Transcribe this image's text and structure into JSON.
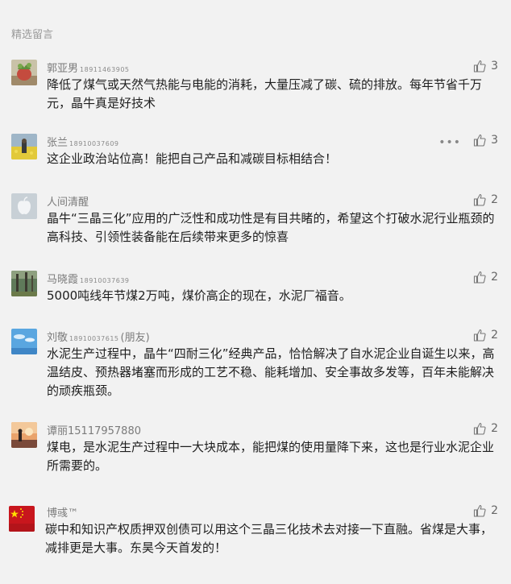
{
  "section_title": "精选留言",
  "comments": [
    {
      "name": "郭亚男",
      "phone": "18911463905",
      "text": "降低了煤气或天然气热能与电能的消耗，大量压减了碳、硫的排放。每年节省千万元，晶牛真是好技术",
      "likes": "3",
      "avatar": "avatar-plant"
    },
    {
      "name": "张兰",
      "phone": "18910037609",
      "text": "这企业政治站位高！能把自己产品和减碳目标相结合！",
      "likes": "3",
      "more": "•••",
      "avatar": "avatar-flower-field"
    },
    {
      "name": "人间清醒",
      "text": "晶牛“三晶三化”应用的广泛性和成功性是有目共睹的，希望这个打破水泥行业瓶颈的高科技、引领性装备能在后续带来更多的惊喜",
      "likes": "2",
      "avatar": "avatar-apple"
    },
    {
      "name": "马晓霞",
      "phone": "18910037639",
      "text": "5000吨线年节煤2万吨，煤价高企的现在，水泥厂福音。",
      "likes": "2",
      "avatar": "avatar-forest"
    },
    {
      "name": "刘敬",
      "phone": "18910037615",
      "suffix": "(朋友)",
      "text": "水泥生产过程中，晶牛“四耐三化”经典产品，恰恰解决了自水泥企业自诞生以来，高温结皮、预热器堵塞而形成的工艺不稳、能耗增加、安全事故多发等，百年未能解决的顽疾瓶颈。",
      "likes": "2",
      "avatar": "avatar-sky"
    },
    {
      "name": "谭丽",
      "phone_big": "15117957880",
      "text": "煤电，是水泥生产过程中一大块成本，能把煤的使用量降下来，这也是行业水泥企业所需要的。",
      "likes": "2",
      "avatar": "avatar-sunset"
    },
    {
      "name": "博彧™",
      "text": "碳中和知识产权质押双创债可以用这个三晶三化技术去对接一下直融。省煤是大事，减排更是大事。东昊今天首发的！",
      "likes": "2",
      "avatar": "avatar-flag"
    }
  ],
  "colors": {
    "background": "#f2f2f2",
    "name": "#7b7b7b",
    "text": "#1e1e1e"
  },
  "icons": {
    "like": "thumbs-up-icon",
    "more": "more-dots-icon"
  }
}
